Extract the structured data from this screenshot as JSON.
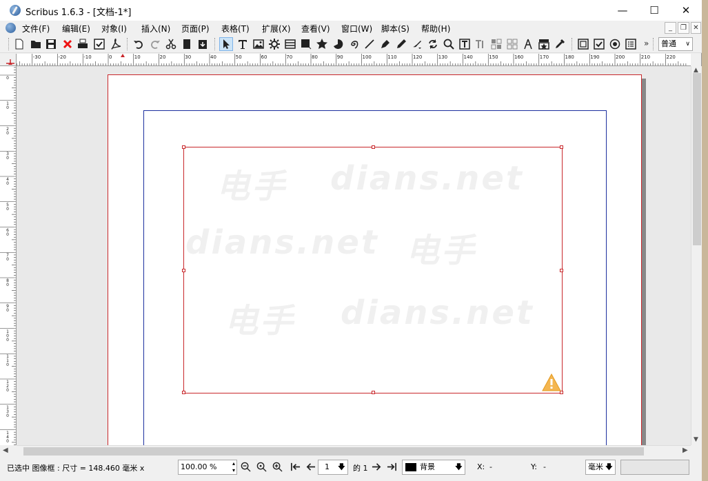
{
  "window": {
    "title": "Scribus 1.6.3 - [文档-1*]",
    "controls": {
      "minimize": "—",
      "maximize": "☐",
      "close": "✕"
    }
  },
  "menubar": {
    "items": [
      "文件(F)",
      "编辑(E)",
      "对象(I)",
      "插入(N)",
      "页面(P)",
      "表格(T)",
      "扩展(X)",
      "查看(V)",
      "窗口(W)",
      "脚本(S)",
      "帮助(H)"
    ],
    "mdi": {
      "minimize": "_",
      "restore": "❐",
      "close": "✕"
    }
  },
  "toolbar": {
    "buttons": [
      {
        "name": "new-document",
        "icon": "new-page-icon"
      },
      {
        "name": "open",
        "icon": "folder-icon"
      },
      {
        "name": "save",
        "icon": "floppy-icon"
      },
      {
        "name": "close-doc",
        "icon": "red-x-icon"
      },
      {
        "name": "print",
        "icon": "printer-icon"
      },
      {
        "name": "preflight",
        "icon": "checkbox-icon"
      },
      {
        "name": "export-pdf",
        "icon": "pdf-icon"
      },
      {
        "name": "undo",
        "icon": "undo-icon"
      },
      {
        "name": "redo",
        "icon": "redo-icon"
      },
      {
        "name": "cut",
        "icon": "scissors-icon"
      },
      {
        "name": "copy",
        "icon": "copy-icon"
      },
      {
        "name": "paste",
        "icon": "paste-icon"
      },
      {
        "name": "select",
        "icon": "cursor-icon"
      },
      {
        "name": "text-frame",
        "icon": "text-t-icon"
      },
      {
        "name": "image-frame",
        "icon": "image-icon"
      },
      {
        "name": "render-frame",
        "icon": "gear-icon"
      },
      {
        "name": "table",
        "icon": "table-icon"
      },
      {
        "name": "shape",
        "icon": "square-icon"
      },
      {
        "name": "polygon",
        "icon": "star-icon"
      },
      {
        "name": "arc",
        "icon": "arc-icon"
      },
      {
        "name": "spiral",
        "icon": "spiral-icon"
      },
      {
        "name": "line",
        "icon": "line-icon"
      },
      {
        "name": "bezier",
        "icon": "pen-icon"
      },
      {
        "name": "freehand",
        "icon": "pencil-icon"
      },
      {
        "name": "calligraphic",
        "icon": "brush-icon"
      },
      {
        "name": "rotate",
        "icon": "rotate-icon"
      },
      {
        "name": "zoom",
        "icon": "magnifier-icon"
      },
      {
        "name": "edit-text",
        "icon": "text-box-icon"
      },
      {
        "name": "story-editor",
        "icon": "ti-icon"
      },
      {
        "name": "link-frames",
        "icon": "link-frames-icon"
      },
      {
        "name": "unlink-frames",
        "icon": "unlink-frames-icon"
      },
      {
        "name": "measure",
        "icon": "compass-icon"
      },
      {
        "name": "copy-properties",
        "icon": "stamp-icon"
      },
      {
        "name": "eyedropper",
        "icon": "eyedropper-icon"
      },
      {
        "name": "pdf-button",
        "icon": "pdf-button-icon"
      },
      {
        "name": "pdf-checkbox",
        "icon": "pdf-checkbox-icon"
      },
      {
        "name": "pdf-radio",
        "icon": "pdf-radio-icon"
      },
      {
        "name": "pdf-list",
        "icon": "pdf-list-icon"
      }
    ],
    "more": "»",
    "mode_select": "普通"
  },
  "ruler_h": {
    "labels": [
      "-30",
      "-20",
      "-10",
      "0",
      "10",
      "20",
      "30",
      "40",
      "50",
      "60",
      "70",
      "80",
      "90",
      "100",
      "110",
      "120",
      "130",
      "140",
      "150",
      "160",
      "170",
      "180",
      "190",
      "200",
      "210",
      "220"
    ]
  },
  "ruler_v": {
    "labels": [
      "0",
      "10",
      "20",
      "30",
      "40",
      "50",
      "60",
      "70",
      "80",
      "90",
      "100",
      "110",
      "120",
      "130",
      "140"
    ]
  },
  "canvas": {
    "watermark_cn": "电手",
    "watermark_en": "dians.net"
  },
  "status": {
    "selection": "已选中 图像框 : 尺寸 = 148.460 毫米 x",
    "zoom": "100.00 %",
    "page_current": "1",
    "page_of": "的 1",
    "layer": "背景",
    "x_label": "X:",
    "x_value": "-",
    "y_label": "Y:",
    "y_value": "-",
    "unit": "毫米"
  }
}
